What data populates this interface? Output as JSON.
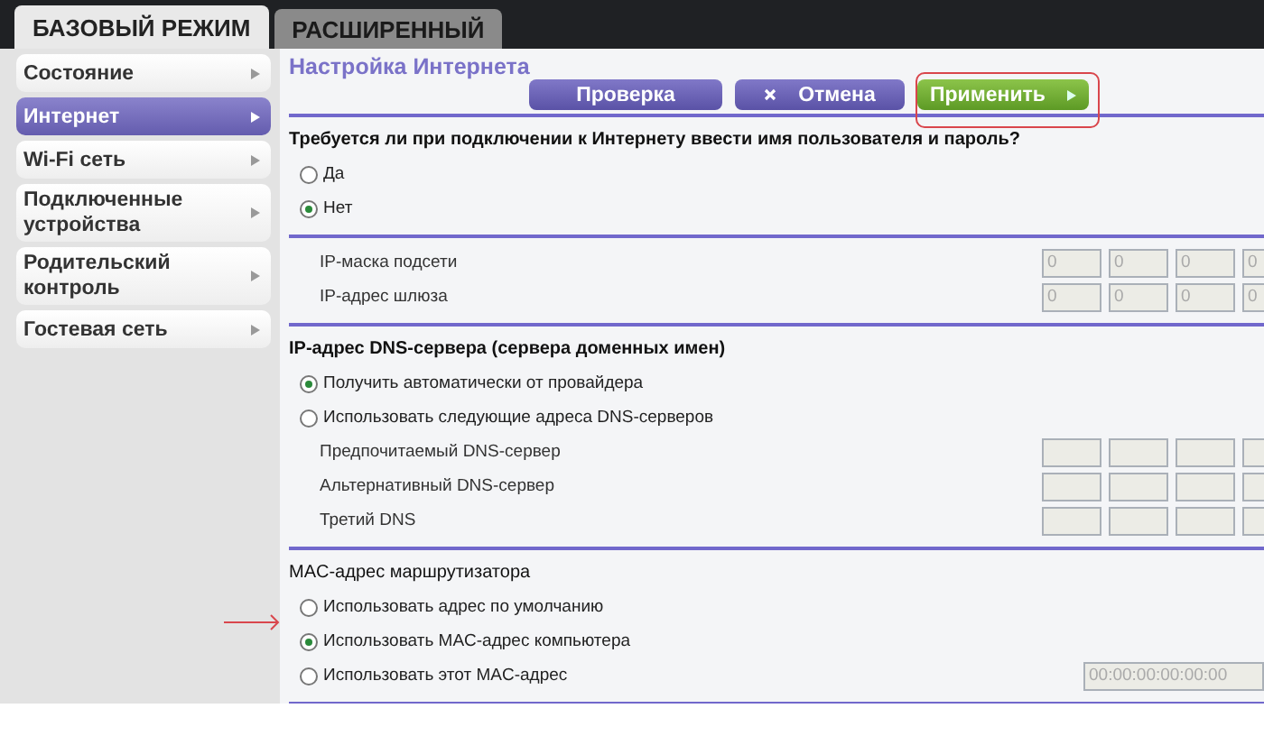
{
  "tabs": [
    {
      "label": "БАЗОВЫЙ РЕЖИМ",
      "selected": true
    },
    {
      "label": "РАСШИРЕННЫЙ",
      "selected": false
    }
  ],
  "sidebar": {
    "items": [
      {
        "label": "Состояние",
        "selected": false
      },
      {
        "label": "Интернет",
        "selected": true
      },
      {
        "label": "Wi-Fi сеть",
        "selected": false
      },
      {
        "label": "Подключенные устройства",
        "selected": false
      },
      {
        "label": "Родительский контроль",
        "selected": false
      },
      {
        "label": "Гостевая сеть",
        "selected": false
      }
    ]
  },
  "page": {
    "title": "Настройка Интернета",
    "buttons": [
      {
        "label": "Проверка",
        "kind": "check"
      },
      {
        "label": "Отмена",
        "kind": "cancel"
      },
      {
        "label": "Применить",
        "kind": "apply"
      }
    ],
    "sections": [
      {
        "title": "Требуется ли при подключении к Интернету ввести имя пользователя и пароль?",
        "bold": true,
        "options": [
          {
            "label": "Да",
            "selected": false
          },
          {
            "label": "Нет",
            "selected": true
          }
        ]
      },
      {
        "fields": [
          {
            "label": "IP-маска подсети",
            "values": [
              "0",
              "0",
              "0",
              "0"
            ]
          },
          {
            "label": "IP-адрес шлюза",
            "values": [
              "0",
              "0",
              "0",
              "0"
            ]
          }
        ]
      },
      {
        "title": "IP-адрес DNS-сервера (сервера доменных имен)",
        "bold": true,
        "options": [
          {
            "label": "Получить автоматически от провайдера",
            "selected": true
          },
          {
            "label": "Использовать следующие адреса DNS-серверов",
            "selected": false
          }
        ],
        "fields": [
          {
            "label": "Предпочитаемый DNS-сервер"
          },
          {
            "label": "Альтернативный DNS-сервер"
          },
          {
            "label": "Третий DNS"
          }
        ]
      },
      {
        "title": "MAC-адрес маршрутизатора",
        "bold": false,
        "options": [
          {
            "label": "Использовать адрес по умолчанию",
            "selected": false
          },
          {
            "label": "Использовать MAC-адрес компьютера",
            "selected": true
          },
          {
            "label": "Использовать этот MAC-адрес",
            "selected": false,
            "value": "00:00:00:00:00:00"
          }
        ]
      }
    ]
  }
}
